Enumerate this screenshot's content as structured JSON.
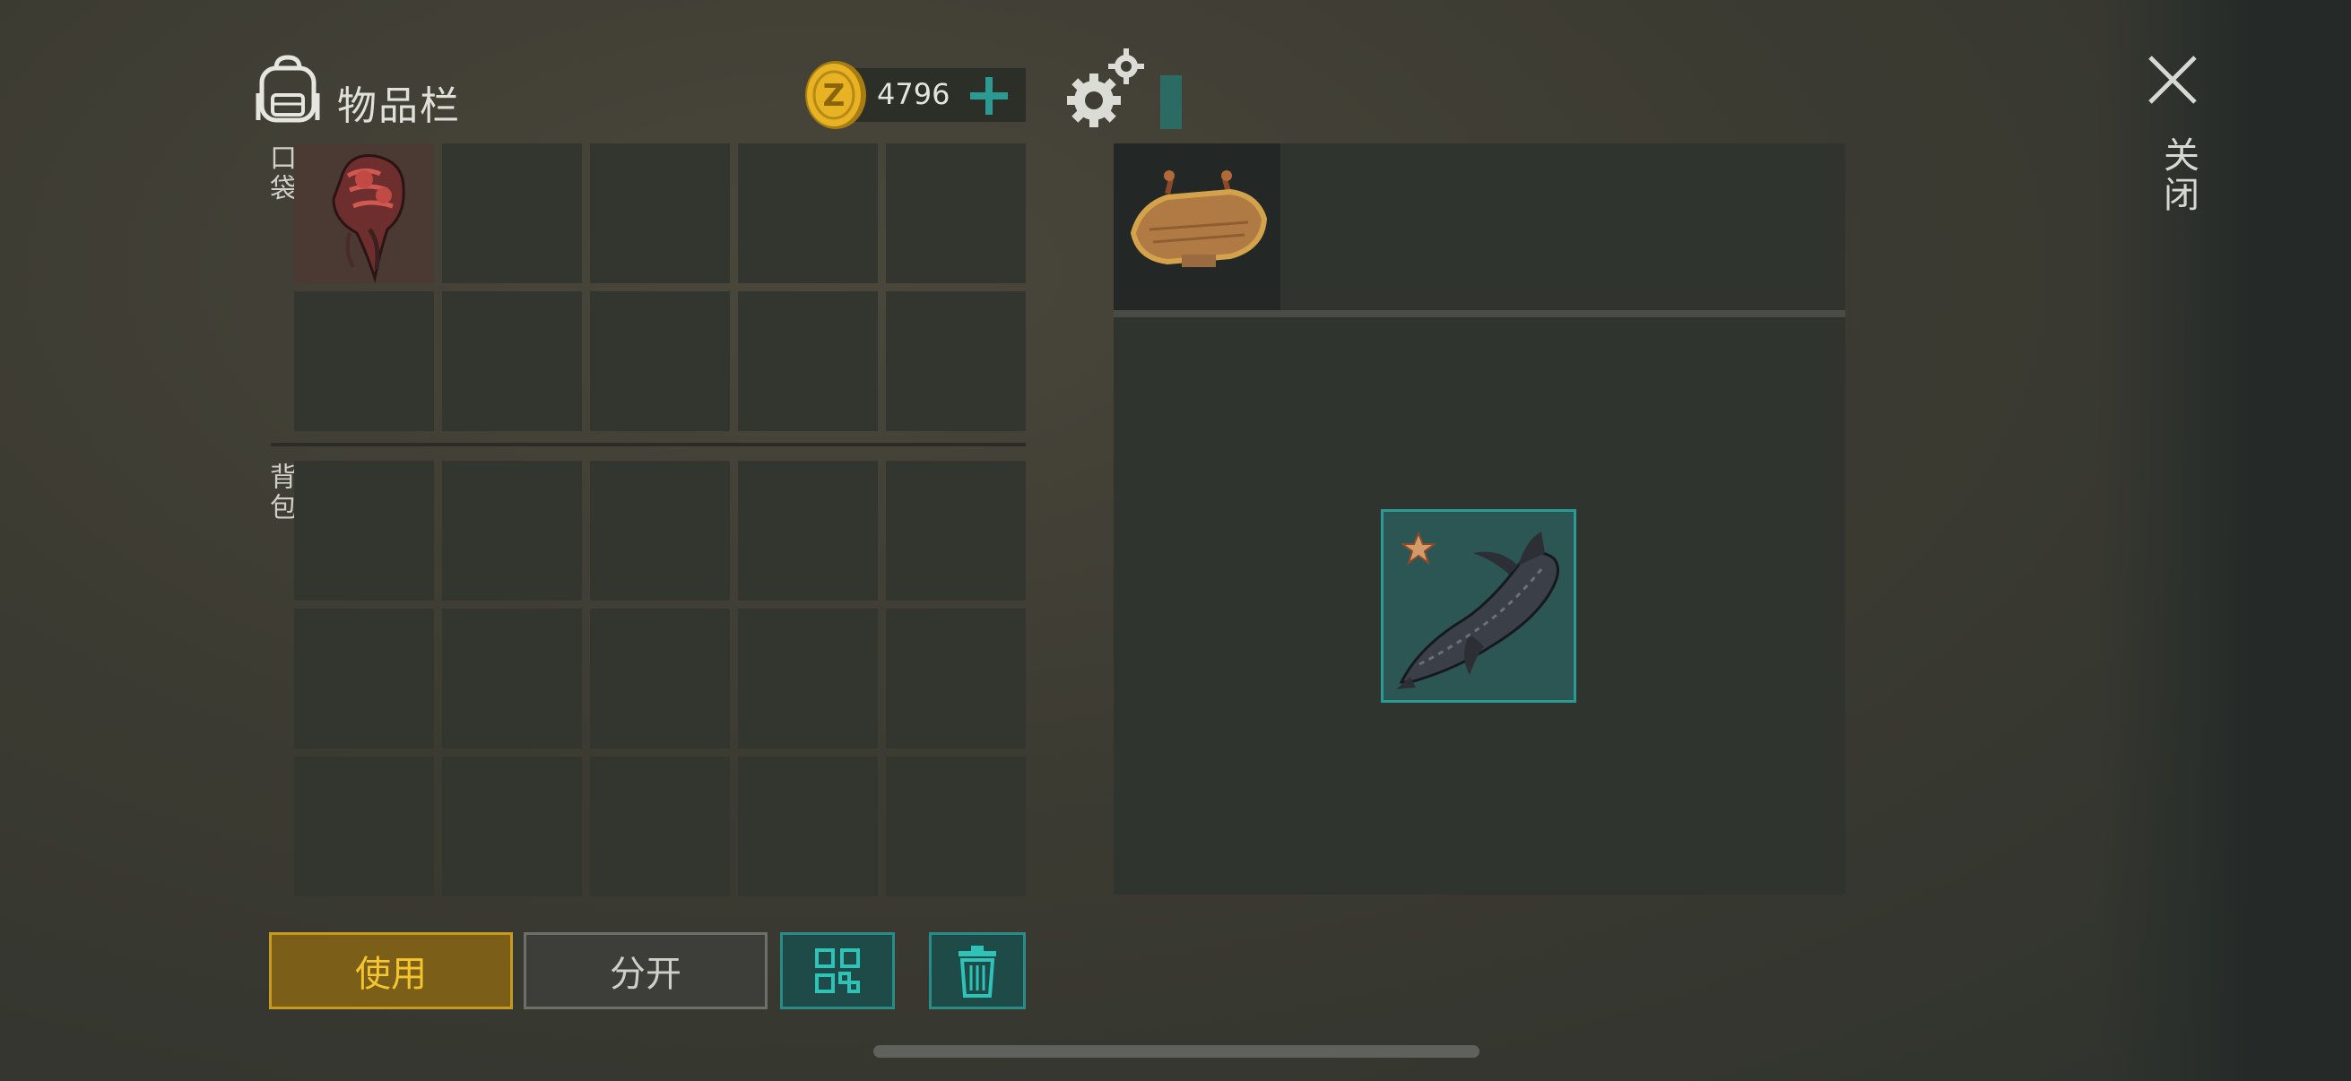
{
  "header": {
    "title": "物品栏",
    "backpack_icon": "backpack-icon",
    "coins": "4796",
    "coin_icon": "coin-z-icon",
    "add_icon": "plus-icon",
    "settings_icon": "gears-icon"
  },
  "close": {
    "label": "关闭",
    "icon": "close-x-icon"
  },
  "inventory": {
    "pocket_label": "口袋",
    "backpack_label": "背包",
    "pocket_slots": [
      {
        "item": "mutant-brain-meat"
      },
      {},
      {},
      {},
      {},
      {},
      {},
      {},
      {},
      {}
    ],
    "backpack_slots": [
      {},
      {},
      {},
      {},
      {},
      {},
      {},
      {},
      {},
      {},
      {},
      {},
      {},
      {},
      {}
    ]
  },
  "container": {
    "sign_item": "wooden-sign",
    "stored_item": "sturgeon-fish",
    "stored_item_rarity_icon": "star-icon"
  },
  "actions": {
    "use_label": "使用",
    "split_label": "分开",
    "sort_icon": "grid-sort-icon",
    "delete_icon": "trash-icon"
  },
  "colors": {
    "accent_teal": "#2a8c88",
    "use_gold": "#f5c52e",
    "coin_gold": "#e8b225"
  }
}
